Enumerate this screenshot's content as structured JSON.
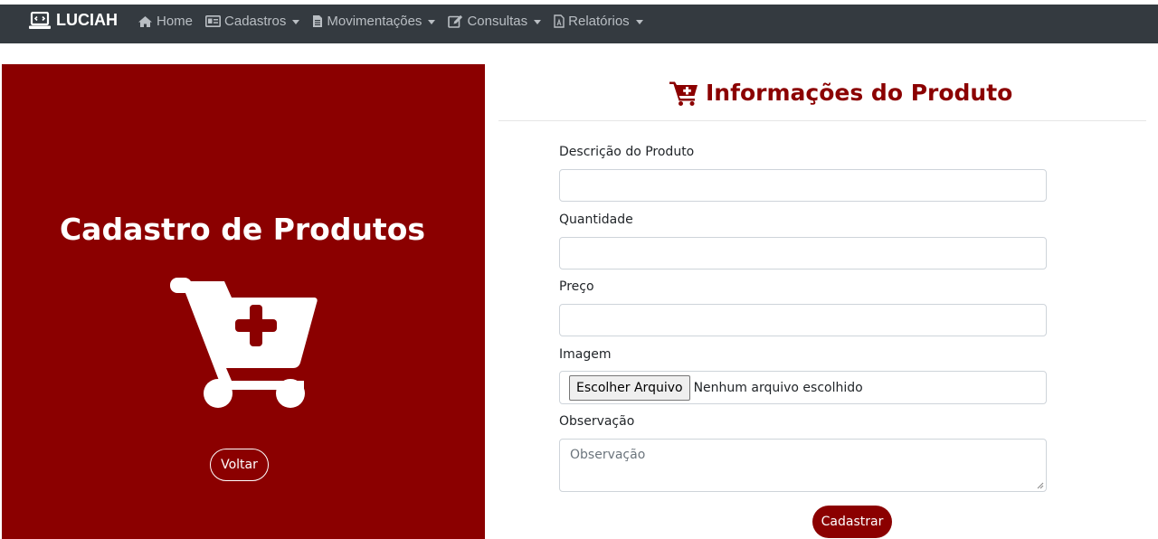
{
  "navbar": {
    "brand": "LUCIAH",
    "items": [
      {
        "label": "Home",
        "icon": "home-icon",
        "dropdown": false
      },
      {
        "label": "Cadastros",
        "icon": "id-card-icon",
        "dropdown": true
      },
      {
        "label": "Movimentações",
        "icon": "file-text-icon",
        "dropdown": true
      },
      {
        "label": "Consultas",
        "icon": "edit-icon",
        "dropdown": true
      },
      {
        "label": "Relatórios",
        "icon": "file-pdf-icon",
        "dropdown": true
      }
    ]
  },
  "left": {
    "title": "Cadastro de Produtos",
    "back_label": "Voltar"
  },
  "form": {
    "title": "Informações do Produto",
    "descricao_label": "Descrição do Produto",
    "descricao_value": "",
    "quantidade_label": "Quantidade",
    "quantidade_value": "",
    "preco_label": "Preço",
    "preco_value": "",
    "imagem_label": "Imagem",
    "file_button": "Escolher Arquivo",
    "file_status": "Nenhum arquivo escolhido",
    "observacao_label": "Observação",
    "observacao_placeholder": "Observação",
    "submit_label": "Cadastrar"
  },
  "colors": {
    "accent": "#8b0000",
    "navbar_bg": "#343a40",
    "nav_text": "#b9bec3"
  }
}
